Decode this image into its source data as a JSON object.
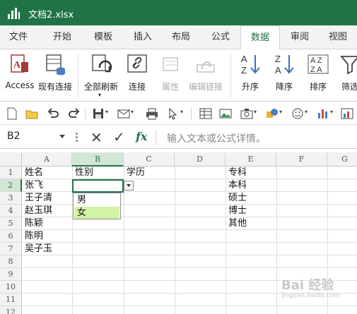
{
  "app": {
    "title": "文档2.xlsx"
  },
  "tabs": [
    {
      "label": "文件"
    },
    {
      "label": "开始"
    },
    {
      "label": "模板"
    },
    {
      "label": "插入"
    },
    {
      "label": "布局"
    },
    {
      "label": "公式"
    },
    {
      "label": "数据",
      "active": true
    },
    {
      "label": "审阅"
    },
    {
      "label": "视图"
    }
  ],
  "ribbon": {
    "access": "Access",
    "existing_connection": "现有连接",
    "refresh_all": "全部刷新",
    "connections": "连接",
    "properties": "属性",
    "edit_links": "编辑链接",
    "sort_asc": "升序",
    "sort_desc": "降序",
    "sort": "排序",
    "filter": "筛选"
  },
  "formula_bar": {
    "name_box": "B2",
    "fx_label": "fx",
    "placeholder": "输入文本或公式详情。"
  },
  "grid": {
    "columns": [
      "A",
      "B",
      "C",
      "D",
      "E",
      "F",
      "G"
    ],
    "rows": [
      "1",
      "2",
      "3",
      "4",
      "5",
      "6",
      "7",
      "8",
      "9",
      "10",
      "11",
      "12"
    ],
    "cells": {
      "A1": "姓名",
      "B1": "性别",
      "C1": "学历",
      "E1": "专科",
      "A2": "张飞",
      "E2": "本科",
      "A3": "王子清",
      "E3": "硕士",
      "A4": "赵玉琪",
      "E4": "博士",
      "A5": "陈颖",
      "E5": "其他",
      "A6": "陈明",
      "A7": "吴子玉"
    },
    "active_cell": "B2"
  },
  "dropdown": {
    "options": [
      "男",
      "女"
    ],
    "highlighted": "女"
  },
  "watermark": {
    "text": "Bai 经验",
    "sub": "jingyan.baidu.com"
  },
  "colors": {
    "accent": "#217346",
    "hover": "#d3f3a4"
  }
}
